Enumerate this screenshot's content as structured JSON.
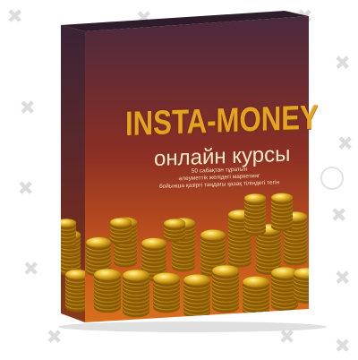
{
  "product": {
    "title": "INSTA-MONEY",
    "subtitle": "онлайн курсы",
    "description_lines": [
      "50 сабақтан тұратын",
      "әлеуметтік желідегі маркетинг",
      "бойынша қазіргі таңдағы қазақ тіліндегі тегін"
    ]
  },
  "colors": {
    "background": "#ffffff",
    "box_front_top": "#4a2a3e",
    "box_front_mid": "#8c2f24",
    "box_front_bottom": "#c2531c",
    "box_side": "#3a2436",
    "title_gold": "#e6a320",
    "coin_gold": "#d9a41a"
  },
  "icons": {
    "watermark": "cross-watermark-icon",
    "watermark_logo": "circle-logo-watermark-icon"
  }
}
